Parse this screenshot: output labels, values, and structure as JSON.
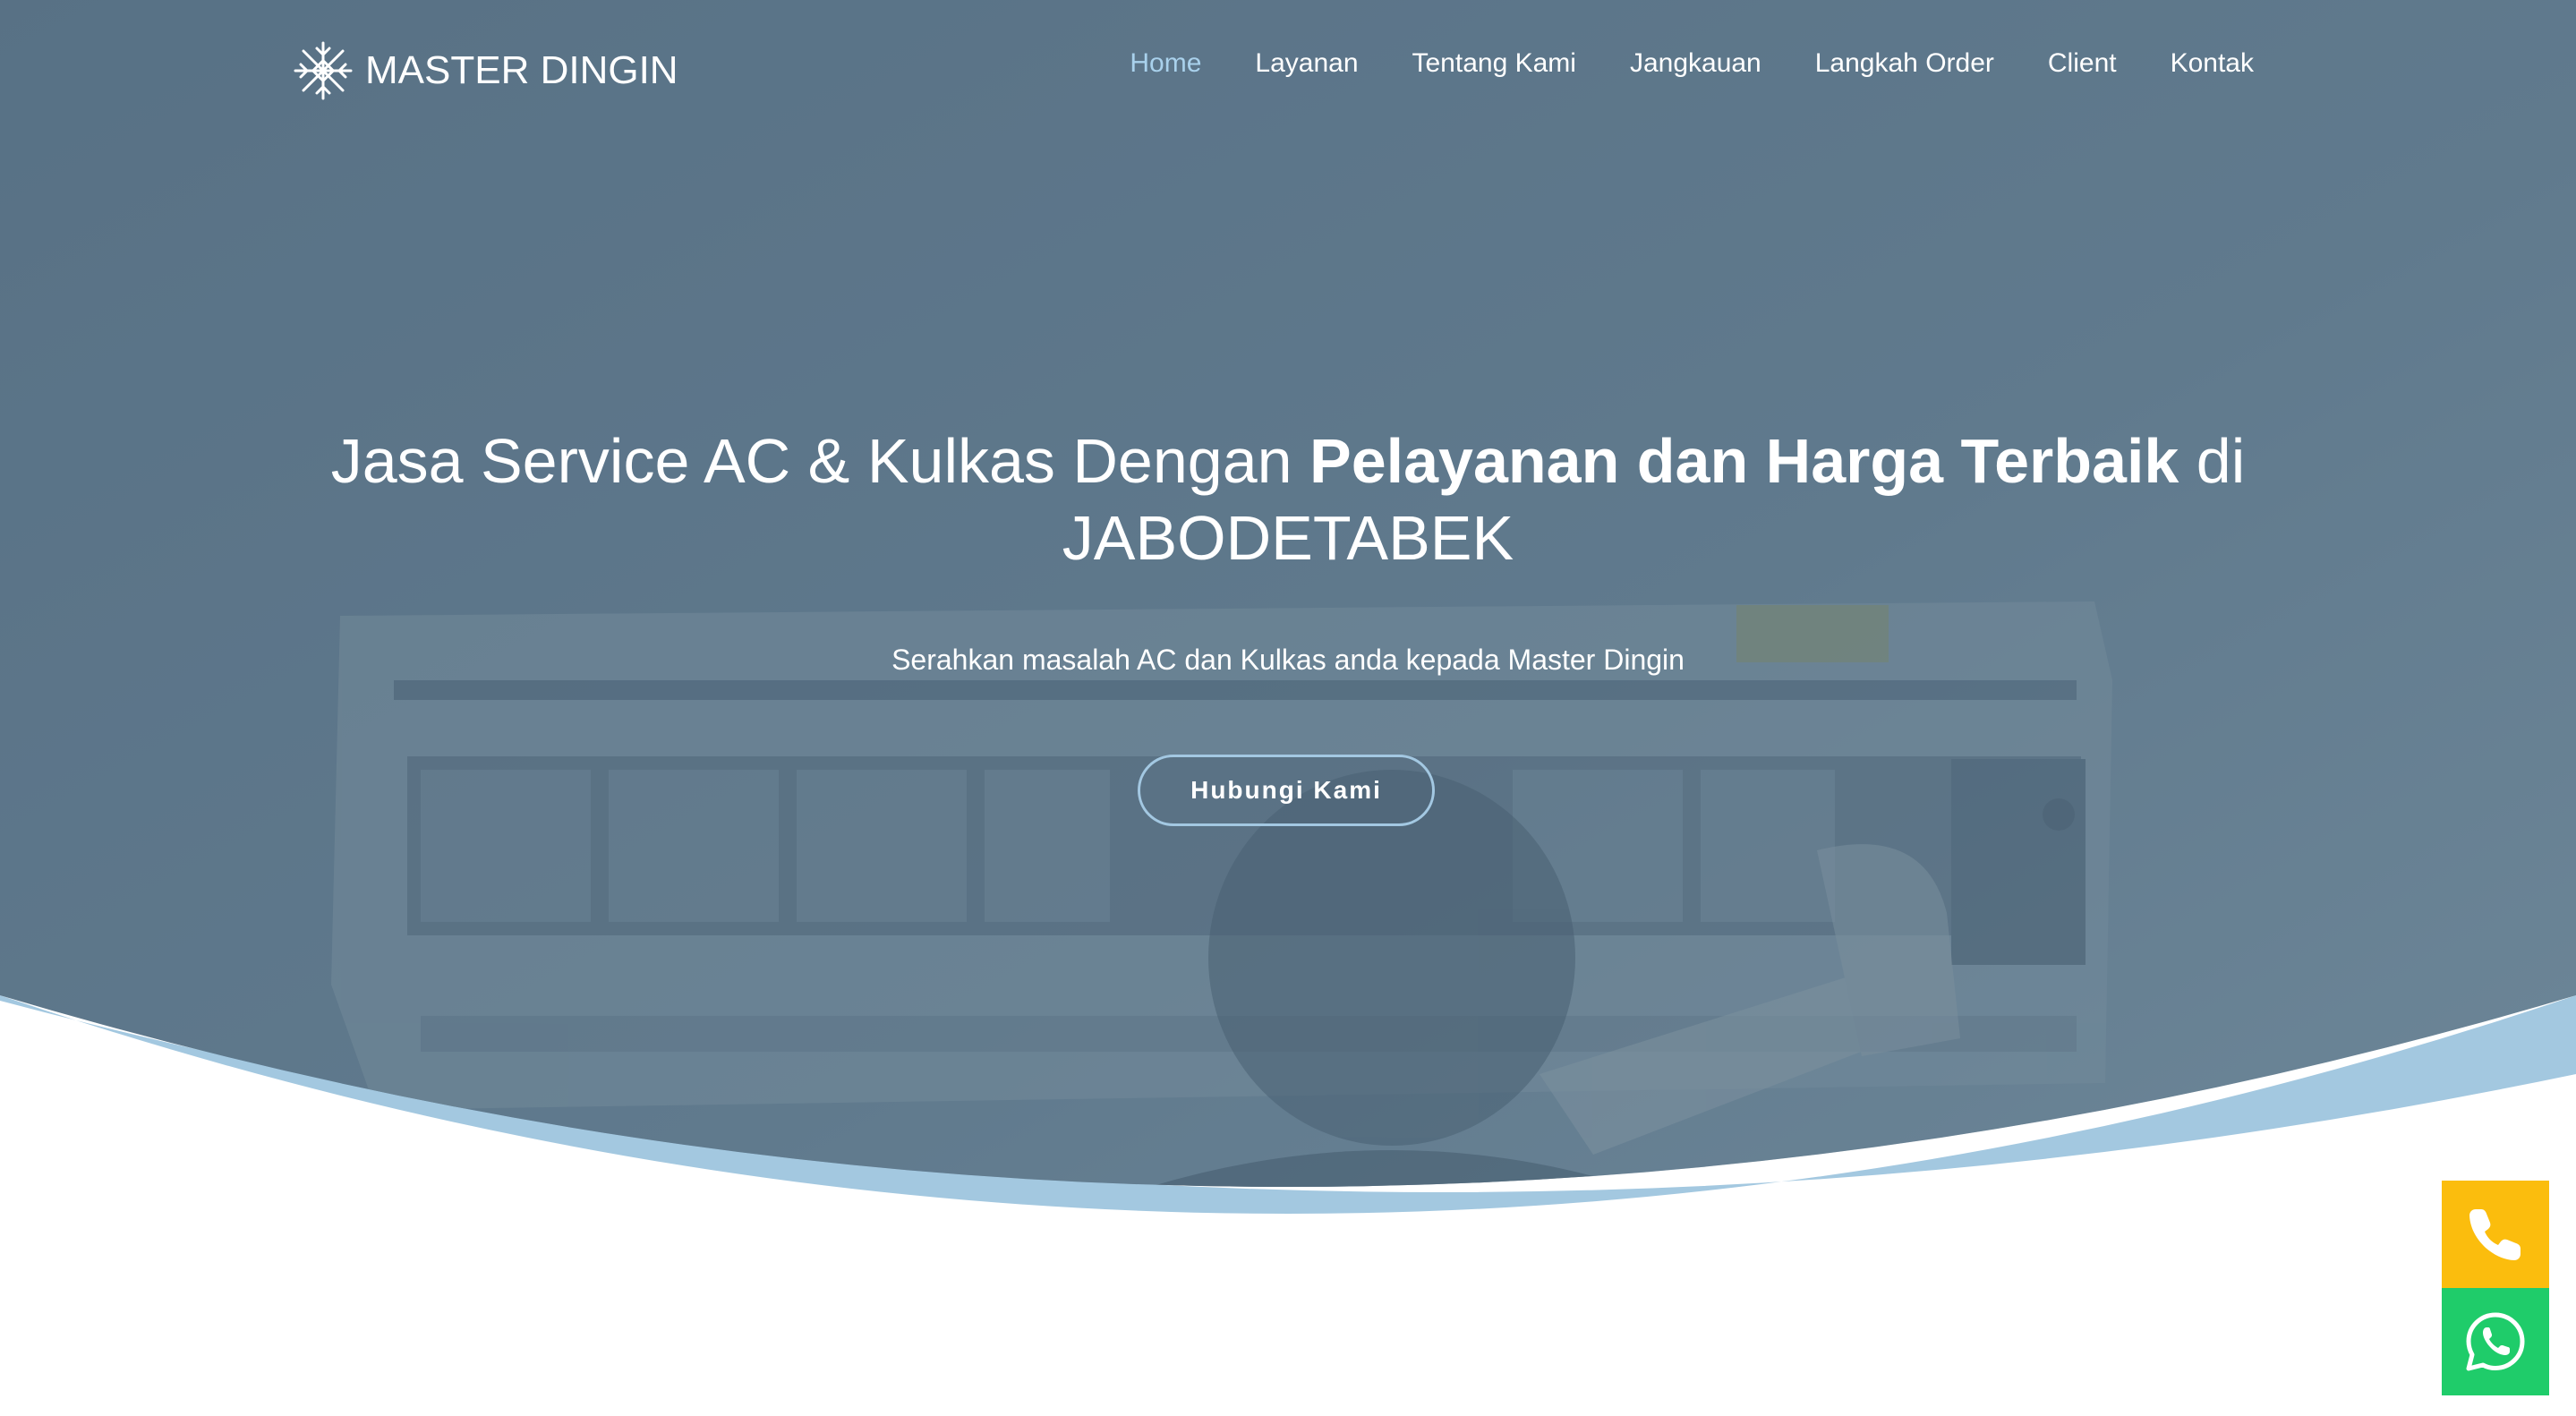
{
  "brand": {
    "name": "MASTER DINGIN",
    "logo_icon": "snowflake-icon"
  },
  "nav": {
    "items": [
      {
        "label": "Home",
        "active": true
      },
      {
        "label": "Layanan",
        "active": false
      },
      {
        "label": "Tentang Kami",
        "active": false
      },
      {
        "label": "Jangkauan",
        "active": false
      },
      {
        "label": "Langkah Order",
        "active": false
      },
      {
        "label": "Client",
        "active": false
      },
      {
        "label": "Kontak",
        "active": false
      }
    ]
  },
  "hero": {
    "title_part1": "Jasa Service AC & Kulkas Dengan ",
    "title_bold1": "Pelayanan dan Harga Terbaik",
    "title_part2": " di JABODETABEK",
    "subtitle": "Serahkan masalah AC dan Kulkas anda kepada Master Dingin",
    "cta_label": "Hubungi Kami"
  },
  "floating_buttons": {
    "phone_icon": "phone-icon",
    "whatsapp_icon": "whatsapp-icon"
  },
  "colors": {
    "overlay": "#5b7689",
    "wave_band": "#a3c8e0",
    "nav_active": "#a9d1ec",
    "phone_button": "#fbbd0d",
    "whatsapp_button": "#1fcc6a",
    "cta_border": "#a3c8e2"
  }
}
